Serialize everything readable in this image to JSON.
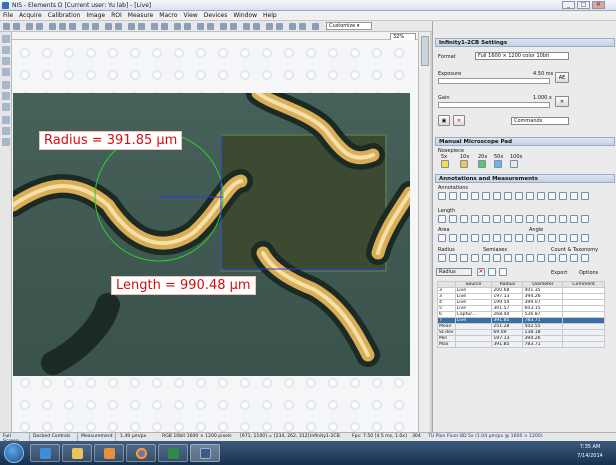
{
  "window": {
    "title": "NIS - Elements D [Current user: Yu lab] - [Live]",
    "buttons": [
      "_",
      "□",
      "✕"
    ]
  },
  "menu": [
    "File",
    "Acquire",
    "Calibration",
    "Image",
    "ROI",
    "Measure",
    "Macro",
    "View",
    "Devices",
    "Window",
    "Help"
  ],
  "toolbar": {
    "customize": "Customize ▾"
  },
  "zoom": "32%",
  "image": {
    "radius_label": "Radius = 391.85 µm",
    "length_label": "Length = 990.48 µm"
  },
  "statusbar": {
    "tabs": [
      "Full Screen",
      "Docked Controls",
      "Measurement"
    ],
    "zoom": "1.49 µm/px",
    "format": "RGB 10bit 1600 × 1200 pixels",
    "coords": "[971, 1100] = [234, 262, 312]",
    "camera": "Infinity1-2CB",
    "fps": "Fps: 7.50 [4.5 ms, 1.0x]",
    "count": "304",
    "objective": "TU Plan Fluor BD 5x (1.04 µm/px @ 1600 × 1200)"
  },
  "settings": {
    "header": "Infinity1-2CB Settings",
    "format_label": "Format",
    "format_value": "Full 1600 × 1200 color 10bit",
    "exposure_label": "Exposure",
    "exposure_value": "4.50 ms",
    "gain_label": "Gain",
    "gain_value": "1.000 x",
    "ae_label": "AE",
    "commands_label": "Commands"
  },
  "micropad": {
    "header": "Manual Microscope Pad",
    "nosepiece_label": "Nosepiece",
    "objectives": [
      "5x",
      "10x",
      "20x",
      "50x",
      "100x"
    ]
  },
  "annotations": {
    "header": "Annotations and Measurements",
    "annotations_label": "Annotations",
    "length_label": "Length",
    "area_label": "Area",
    "angle_label": "Angle",
    "radius_label": "Radius",
    "semiaxes_label": "Semiaxes",
    "count_label": "Count & Taxonomy"
  },
  "measure_table": {
    "type_selector": "Radius",
    "export_label": "Export",
    "options_label": "Options",
    "columns": [
      "",
      "Source",
      "Radius",
      "Diameter",
      "Comment"
    ],
    "rows": [
      [
        "3",
        "Live",
        "200.68",
        "401.35",
        ""
      ],
      [
        "3",
        "Live",
        "197.13",
        "394.26",
        ""
      ],
      [
        "4",
        "Live",
        "199.54",
        "399.07",
        ""
      ],
      [
        "5",
        "Live",
        "301.57",
        "603.15",
        ""
      ],
      [
        "6",
        "Captur...",
        "268.44",
        "536.87",
        ""
      ],
      [
        "7",
        "Live",
        "391.85",
        "783.71",
        ""
      ]
    ],
    "summary": [
      [
        "Mean",
        "",
        "251.28",
        "502.55",
        ""
      ],
      [
        "St.dev",
        "",
        "69.09",
        "138.18",
        ""
      ],
      [
        "Min",
        "",
        "197.13",
        "394.26",
        ""
      ],
      [
        "Max",
        "",
        "391.85",
        "783.71",
        ""
      ]
    ]
  },
  "clock": {
    "time": "7:35 AM",
    "date": "7/14/2014"
  }
}
